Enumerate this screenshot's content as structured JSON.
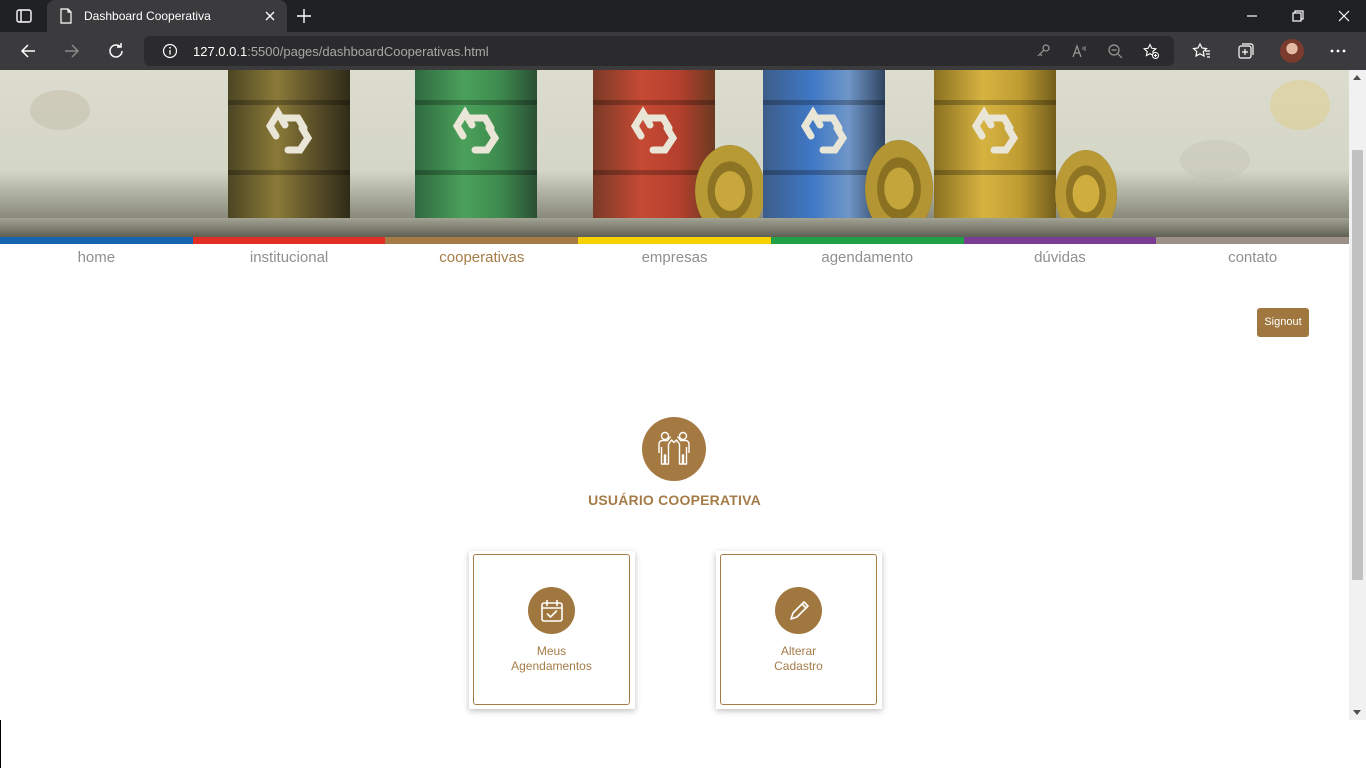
{
  "browser": {
    "tab_title": "Dashboard Cooperativa",
    "url_host": "127.0.0.1",
    "url_rest": ":5500/pages/dashboardCooperativas.html"
  },
  "icons": {
    "window": "window-icon",
    "tab_favicon": "page-icon",
    "tab_close": "close-icon",
    "new_tab": "plus-icon",
    "back": "arrow-left-icon",
    "forward": "arrow-right-icon",
    "reload": "reload-icon",
    "info": "info-icon",
    "key": "key-icon",
    "read_aloud": "read-aloud-icon",
    "zoom": "zoom-out-icon",
    "fav_add": "star-add-icon",
    "favorites": "favorites-icon",
    "collections": "collections-icon",
    "menu": "more-icon",
    "user": "users-icon",
    "calendar": "calendar-check-icon",
    "pencil": "pencil-icon"
  },
  "strip_colors": [
    "#1565b0",
    "#e12f26",
    "#a57c48",
    "#f6d200",
    "#22a048",
    "#7b3d92",
    "#9b8f86"
  ],
  "nav": [
    {
      "label": "home",
      "active": false
    },
    {
      "label": "institucional",
      "active": false
    },
    {
      "label": "cooperativas",
      "active": true
    },
    {
      "label": "empresas",
      "active": false
    },
    {
      "label": "agendamento",
      "active": false
    },
    {
      "label": "dúvidas",
      "active": false
    },
    {
      "label": "contato",
      "active": false
    }
  ],
  "signout_label": "Signout",
  "user_title": "USUÁRIO COOPERATIVA",
  "cards": [
    {
      "line1": "Meus",
      "line2": "Agendamentos"
    },
    {
      "line1": "Alterar",
      "line2": "Cadastro"
    }
  ],
  "colors": {
    "brand": "#a57c48",
    "button": "#a0773f"
  }
}
